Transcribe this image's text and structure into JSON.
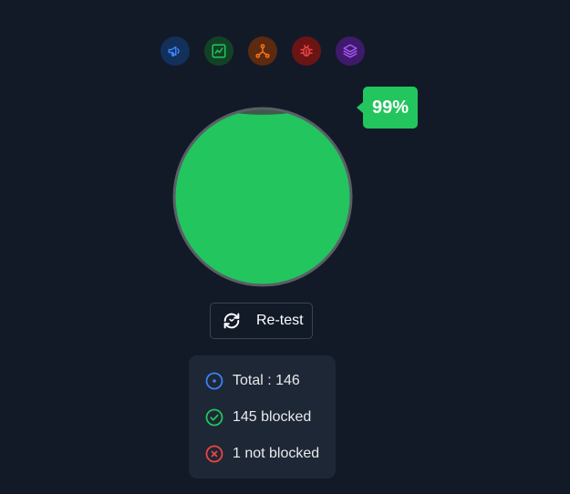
{
  "category_icons": [
    {
      "name": "megaphone-icon",
      "color": "#3b82f6",
      "bg": "#12305a"
    },
    {
      "name": "chart-icon",
      "color": "#22c55e",
      "bg": "#124226"
    },
    {
      "name": "network-icon",
      "color": "#f97316",
      "bg": "#5c2a0f"
    },
    {
      "name": "bug-icon",
      "color": "#ef4444",
      "bg": "#6b1414"
    },
    {
      "name": "layers-icon",
      "color": "#a855f7",
      "bg": "#3f1a6b"
    }
  ],
  "gauge": {
    "percent_label": "99%",
    "blocked_fraction": 0.9932,
    "fill_color": "#22c55e",
    "empty_color": "#3f5a4a",
    "border_color": "#5a5f66"
  },
  "retest_button": {
    "label": "Re-test",
    "icon": "refresh-icon"
  },
  "stats": {
    "total": {
      "label": "Total : 146",
      "icon": "target-icon",
      "color": "#3b82f6"
    },
    "blocked": {
      "label": "145 blocked",
      "icon": "check-circle-icon",
      "color": "#22c55e"
    },
    "not_blocked": {
      "label": "1 not blocked",
      "icon": "x-circle-icon",
      "color": "#ef4444"
    }
  }
}
